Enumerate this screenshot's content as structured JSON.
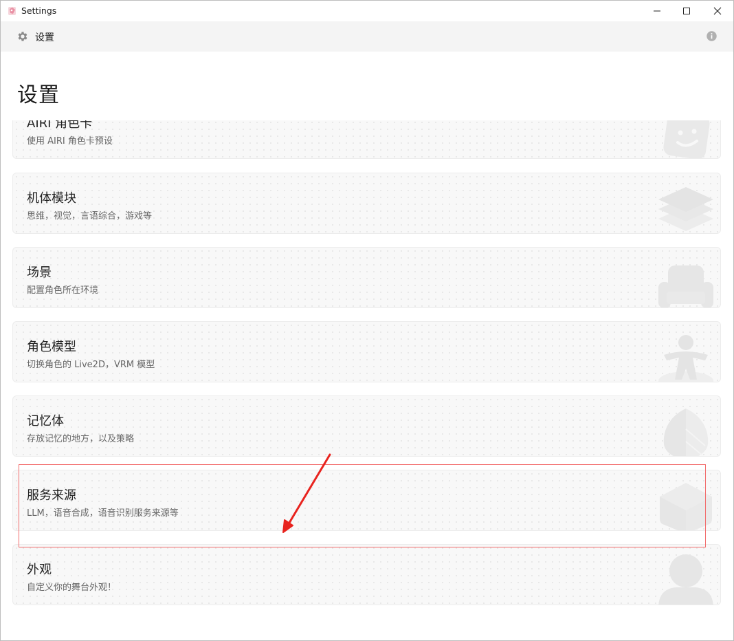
{
  "window": {
    "title": "Settings",
    "controls": [
      "minimize",
      "maximize",
      "close"
    ]
  },
  "toolbar": {
    "icon": "gear-icon",
    "label": "设置",
    "right_icon": "info-icon"
  },
  "page": {
    "title": "设置"
  },
  "cards": [
    {
      "title": "AIRI 角色卡",
      "description": "使用 AIRI 角色卡预设",
      "icon": "smiley-sticker-icon"
    },
    {
      "title": "机体模块",
      "description": "思维，视觉，言语综合，游戏等",
      "icon": "layers-icon"
    },
    {
      "title": "场景",
      "description": "配置角色所在环境",
      "icon": "armchair-icon"
    },
    {
      "title": "角色模型",
      "description": "切换角色的 Live2D，VRM 模型",
      "icon": "person-icon"
    },
    {
      "title": "记忆体",
      "description": "存放记忆的地方，以及策略",
      "icon": "leaf-icon"
    },
    {
      "title": "服务来源",
      "description": "LLM，语音合成，语音识别服务来源等",
      "icon": "cube-icon"
    },
    {
      "title": "外观",
      "description": "自定义你的舞台外观！",
      "icon": "avatar-icon"
    }
  ],
  "annotation": {
    "highlight_color": "#f26b6b",
    "arrow_color": "#e8231e"
  }
}
